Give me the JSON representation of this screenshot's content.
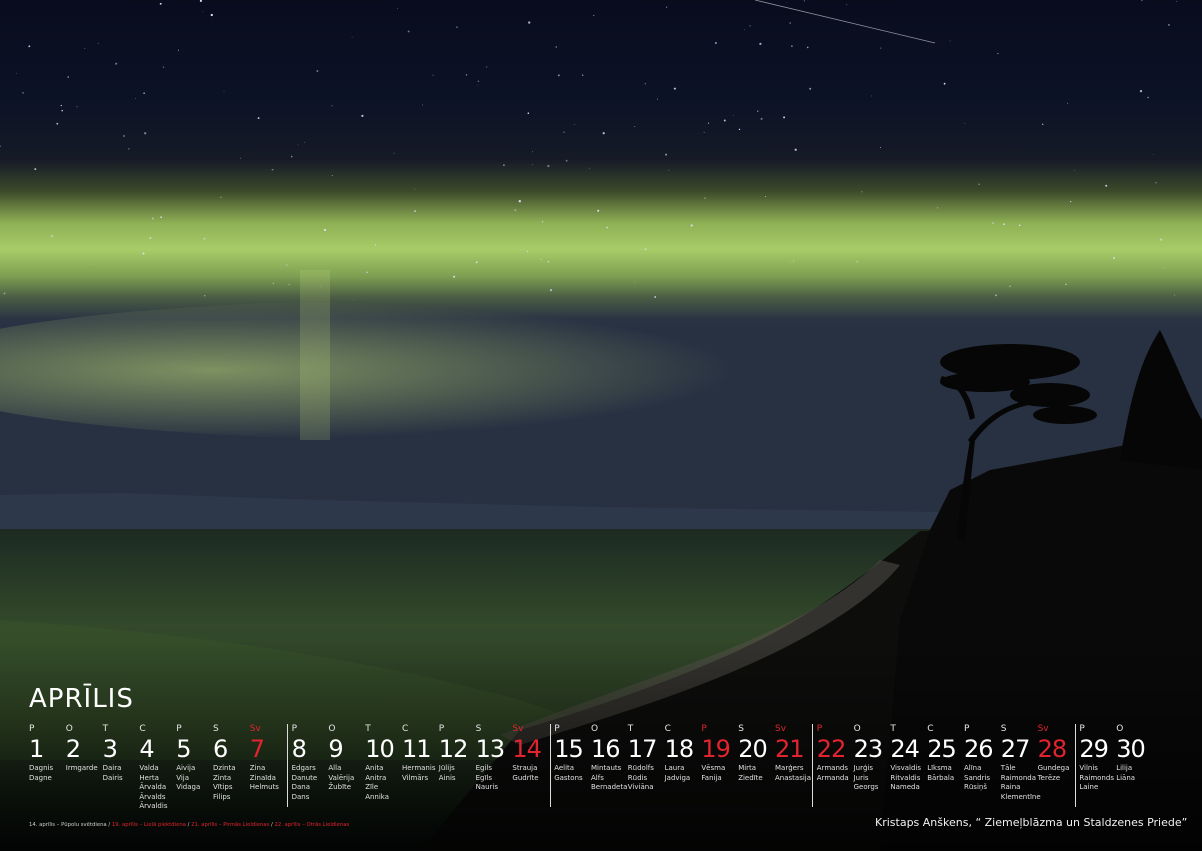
{
  "month": "APRĪLIS",
  "days": [
    {
      "dow": "P",
      "num": "1",
      "names": [
        "Dagnis",
        "Dagne"
      ],
      "red": false
    },
    {
      "dow": "O",
      "num": "2",
      "names": [
        "Irmgarde"
      ],
      "red": false
    },
    {
      "dow": "T",
      "num": "3",
      "names": [
        "Daira",
        "Dairis"
      ],
      "red": false
    },
    {
      "dow": "C",
      "num": "4",
      "names": [
        "Valda",
        "Herta",
        "Ārvalda",
        "Ārvalds",
        "Ārvaldis"
      ],
      "red": false
    },
    {
      "dow": "P",
      "num": "5",
      "names": [
        "Aivija",
        "Vija",
        "Vidaga"
      ],
      "red": false
    },
    {
      "dow": "S",
      "num": "6",
      "names": [
        "Dzinta",
        "Zinta",
        "Vītips",
        "Filips"
      ],
      "red": false
    },
    {
      "dow": "Sv",
      "num": "7",
      "names": [
        "Zina",
        "Zinaīda",
        "Helmuts"
      ],
      "red": true
    },
    {
      "dow": "P",
      "num": "8",
      "names": [
        "Edgars",
        "Danute",
        "Dana",
        "Dans"
      ],
      "red": false
    },
    {
      "dow": "O",
      "num": "9",
      "names": [
        "Alla",
        "Valērija",
        "Žubīte"
      ],
      "red": false
    },
    {
      "dow": "T",
      "num": "10",
      "names": [
        "Anita",
        "Anitra",
        "Zīle",
        "Annika"
      ],
      "red": false
    },
    {
      "dow": "C",
      "num": "11",
      "names": [
        "Hermanis",
        "Vilmārs"
      ],
      "red": false
    },
    {
      "dow": "P",
      "num": "12",
      "names": [
        "Jūlijs",
        "Ainis"
      ],
      "red": false
    },
    {
      "dow": "S",
      "num": "13",
      "names": [
        "Egils",
        "Egīls",
        "Nauris"
      ],
      "red": false
    },
    {
      "dow": "Sv",
      "num": "14",
      "names": [
        "Strauja",
        "Gudrīte"
      ],
      "red": true
    },
    {
      "dow": "P",
      "num": "15",
      "names": [
        "Aelita",
        "Gastons"
      ],
      "red": false
    },
    {
      "dow": "O",
      "num": "16",
      "names": [
        "Mintauts",
        "Alfs",
        "Bernadeta"
      ],
      "red": false
    },
    {
      "dow": "T",
      "num": "17",
      "names": [
        "Rūdolfs",
        "Rūdis",
        "Viviāna"
      ],
      "red": false
    },
    {
      "dow": "C",
      "num": "18",
      "names": [
        "Laura",
        "Jadviga"
      ],
      "red": false
    },
    {
      "dow": "P",
      "num": "19",
      "names": [
        "Vēsma",
        "Fanija"
      ],
      "red": true
    },
    {
      "dow": "S",
      "num": "20",
      "names": [
        "Mirta",
        "Ziedīte"
      ],
      "red": false
    },
    {
      "dow": "Sv",
      "num": "21",
      "names": [
        "Marģers",
        "Anastasija"
      ],
      "red": true
    },
    {
      "dow": "P",
      "num": "22",
      "names": [
        "Armands",
        "Armanda"
      ],
      "red": true
    },
    {
      "dow": "O",
      "num": "23",
      "names": [
        "Jurģis",
        "Juris",
        "Georgs"
      ],
      "red": false
    },
    {
      "dow": "T",
      "num": "24",
      "names": [
        "Visvaldis",
        "Ritvaldis",
        "Nameda"
      ],
      "red": false
    },
    {
      "dow": "C",
      "num": "25",
      "names": [
        "Līksma",
        "Bārbala"
      ],
      "red": false
    },
    {
      "dow": "P",
      "num": "26",
      "names": [
        "Alīna",
        "Sandris",
        "Rūsiņš"
      ],
      "red": false
    },
    {
      "dow": "S",
      "num": "27",
      "names": [
        "Tāle",
        "Raimonda",
        "Raina",
        "Klementīne"
      ],
      "red": false
    },
    {
      "dow": "Sv",
      "num": "28",
      "names": [
        "Gundega",
        "Terēze"
      ],
      "red": true
    },
    {
      "dow": "P",
      "num": "29",
      "names": [
        "Vilnis",
        "Raimonds",
        "Laine"
      ],
      "red": false
    },
    {
      "dow": "O",
      "num": "30",
      "names": [
        "Lilija",
        "Liāna"
      ],
      "red": false
    }
  ],
  "holidays": [
    {
      "text": "14. aprīlis – Pūpolu svētdiena",
      "red": false
    },
    {
      "text": "19. aprīlis – Lielā piektdiena",
      "red": true
    },
    {
      "text": "21. aprīlis – Pirmās Lieldienas",
      "red": true
    },
    {
      "text": "22. aprīlis – Otrās Lieldienas",
      "red": true
    }
  ],
  "credit": "Kristaps Anškens, “ Ziemeļblāzma un Staldzenes Priede”",
  "colors": {
    "accent_red": "#e1242e",
    "sky": "#0a0f22",
    "aurora": "#b4d46a"
  }
}
